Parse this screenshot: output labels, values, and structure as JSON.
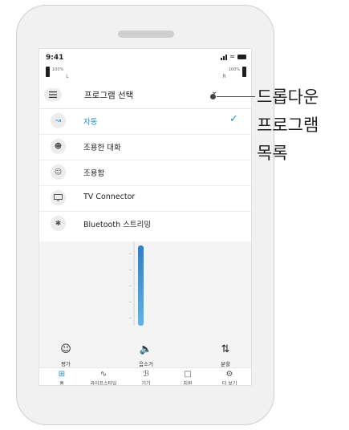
{
  "status_bar": {
    "time": "9:41"
  },
  "hearing_aids": {
    "left": {
      "battery_percent": "100%",
      "side": "L"
    },
    "right": {
      "battery_percent": "100%",
      "side": "R"
    }
  },
  "program_dropdown": {
    "title": "프로그램 선택",
    "menu_icon": "list-icon",
    "chevron_icon": "chevron-down-icon",
    "programs": [
      {
        "label": "자동",
        "icon": "auto-icon",
        "selected": true
      },
      {
        "label": "조용한 대화",
        "icon": "conversation-icon",
        "selected": false
      },
      {
        "label": "조용함",
        "icon": "quiet-icon",
        "selected": false
      },
      {
        "label": "TV Connector",
        "icon": "tv-icon",
        "selected": false
      },
      {
        "label": "Bluetooth 스트리밍",
        "icon": "bluetooth-icon",
        "selected": false
      }
    ]
  },
  "volume": {
    "level_fraction": 1.0
  },
  "actions": [
    {
      "label": "평가",
      "icon": "smiley-icon"
    },
    {
      "label": "음소거",
      "icon": "mute-icon"
    },
    {
      "label": "분할",
      "icon": "split-icon"
    }
  ],
  "tabs": [
    {
      "label": "홈",
      "icon": "home-grid-icon",
      "active": true
    },
    {
      "label": "라이프스타일",
      "icon": "pulse-icon",
      "active": false
    },
    {
      "label": "기기",
      "icon": "hearing-aid-icon",
      "active": false
    },
    {
      "label": "지원",
      "icon": "chat-icon",
      "active": false
    },
    {
      "label": "더 보기",
      "icon": "gear-icon",
      "active": false
    }
  ],
  "callout": {
    "lines": [
      "드롭다운",
      "프로그램",
      "목록"
    ]
  },
  "colors": {
    "accent": "#1e8fd6",
    "slider_top": "#2c7fc8",
    "slider_bottom": "#5fb3e8"
  }
}
